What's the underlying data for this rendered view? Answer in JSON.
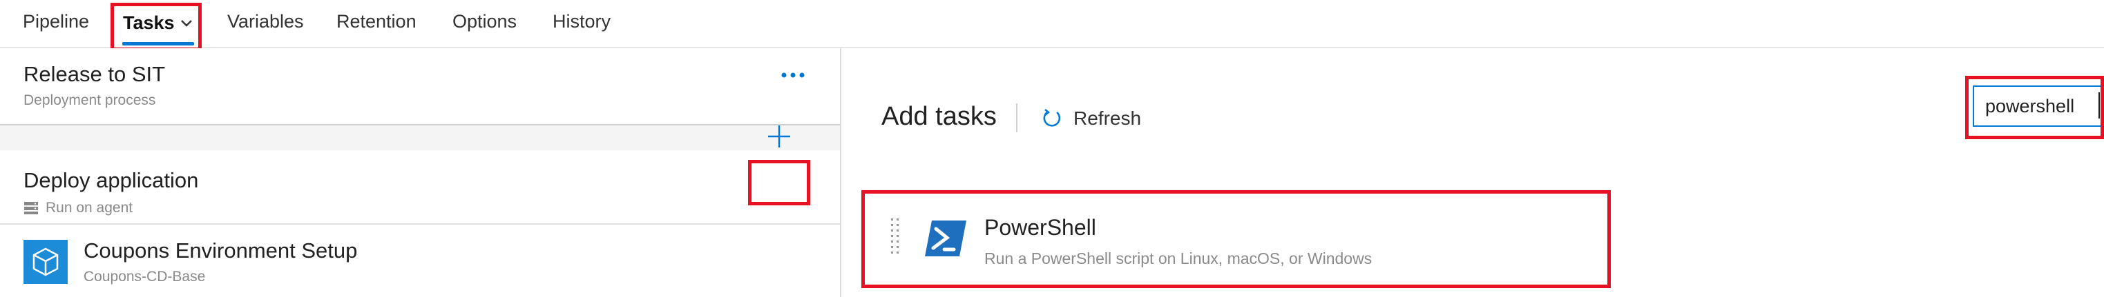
{
  "tabs": [
    {
      "label": "Pipeline",
      "active": false
    },
    {
      "label": "Tasks",
      "active": true
    },
    {
      "label": "Variables",
      "active": false
    },
    {
      "label": "Retention",
      "active": false
    },
    {
      "label": "Options",
      "active": false
    },
    {
      "label": "History",
      "active": false
    }
  ],
  "left": {
    "process_title": "Release to SIT",
    "process_subtitle": "Deployment process",
    "more_icon": "ellipsis-icon",
    "phase": {
      "title": "Deploy application",
      "subtitle": "Run on agent",
      "add_icon": "plus-icon"
    },
    "task": {
      "title": "Coupons Environment Setup",
      "subtitle": "Coupons-CD-Base",
      "icon": "package-icon"
    }
  },
  "right": {
    "title": "Add tasks",
    "refresh_label": "Refresh",
    "search_value": "powershell",
    "result": {
      "title": "PowerShell",
      "description": "Run a PowerShell script on Linux, macOS, or Windows",
      "icon": "powershell-icon"
    }
  },
  "colors": {
    "accent": "#0078d4",
    "highlight": "#e81123",
    "task_icon_bg": "#1c8cd9",
    "powershell_bg": "#1f6fbf"
  }
}
